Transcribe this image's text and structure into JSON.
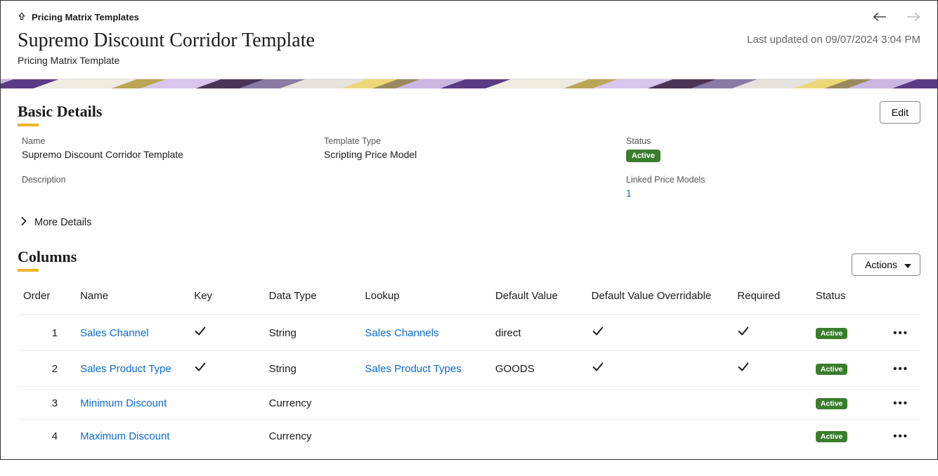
{
  "header": {
    "breadcrumb": "Pricing Matrix Templates",
    "title": "Supremo Discount Corridor Template",
    "subtitle": "Pricing Matrix Template",
    "last_updated": "Last updated on 09/07/2024 3:04 PM"
  },
  "basic_details": {
    "heading": "Basic Details",
    "edit_label": "Edit",
    "fields": {
      "name_label": "Name",
      "name_value": "Supremo Discount Corridor Template",
      "template_type_label": "Template Type",
      "template_type_value": "Scripting Price Model",
      "status_label": "Status",
      "status_value": "Active",
      "description_label": "Description",
      "description_value": "",
      "linked_models_label": "Linked Price Models",
      "linked_models_value": "1"
    },
    "more_details_label": "More Details"
  },
  "columns_section": {
    "heading": "Columns",
    "actions_label": "Actions",
    "headers": {
      "order": "Order",
      "name": "Name",
      "key": "Key",
      "data_type": "Data Type",
      "lookup": "Lookup",
      "default_value": "Default Value",
      "default_overridable": "Default Value Overridable",
      "required": "Required",
      "status": "Status"
    },
    "rows": [
      {
        "order": "1",
        "name": "Sales Channel",
        "key": true,
        "data_type": "String",
        "lookup": "Sales Channels",
        "default_value": "direct",
        "default_overridable": true,
        "required": true,
        "status": "Active"
      },
      {
        "order": "2",
        "name": "Sales Product Type",
        "key": true,
        "data_type": "String",
        "lookup": "Sales Product Types",
        "default_value": "GOODS",
        "default_overridable": true,
        "required": true,
        "status": "Active"
      },
      {
        "order": "3",
        "name": "Minimum Discount",
        "key": false,
        "data_type": "Currency",
        "lookup": "",
        "default_value": "",
        "default_overridable": false,
        "required": false,
        "status": "Active"
      },
      {
        "order": "4",
        "name": "Maximum Discount",
        "key": false,
        "data_type": "Currency",
        "lookup": "",
        "default_value": "",
        "default_overridable": false,
        "required": false,
        "status": "Active"
      }
    ]
  }
}
